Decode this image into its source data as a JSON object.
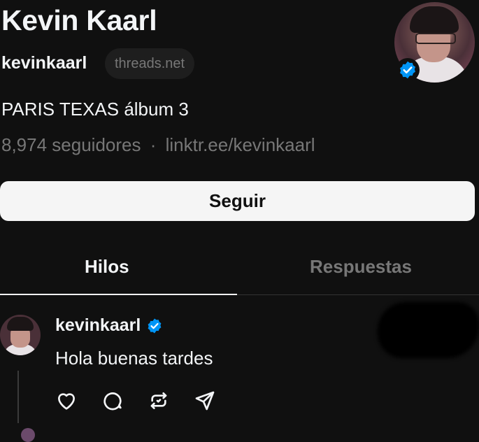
{
  "profile": {
    "name": "Kevin Kaarl",
    "handle": "kevinkaarl",
    "domain": "threads.net",
    "bio": "PARIS TEXAS álbum 3",
    "followers": "8,974 seguidores",
    "separator": "·",
    "link": "linktr.ee/kevinkaarl",
    "verified": true
  },
  "follow_button": {
    "label": "Seguir"
  },
  "tabs": [
    {
      "label": "Hilos",
      "active": true
    },
    {
      "label": "Respuestas",
      "active": false
    }
  ],
  "post": {
    "username": "kevinkaarl",
    "text": "Hola buenas tardes",
    "actions": [
      "heart-icon",
      "comment-icon",
      "repost-icon",
      "share-icon"
    ]
  },
  "colors": {
    "background": "#101010",
    "verified": "#0095f6",
    "muted": "#777777"
  }
}
